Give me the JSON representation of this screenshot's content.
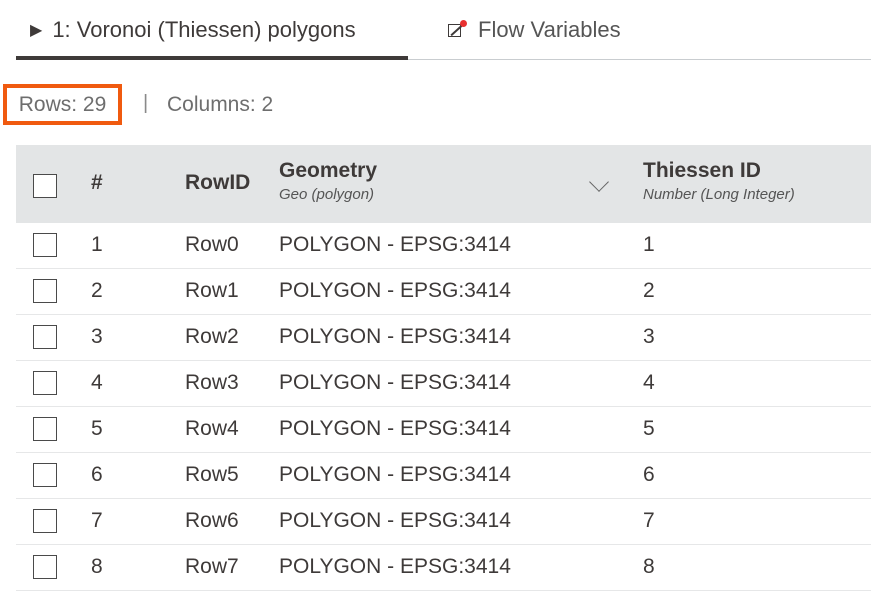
{
  "tabs": [
    {
      "label": "1: Voronoi (Thiessen) polygons",
      "icon": "play-triangle-icon",
      "active": true
    },
    {
      "label": "Flow Variables",
      "icon": "flow-variable-icon",
      "active": false
    }
  ],
  "stats": {
    "rows": "Rows: 29",
    "separator": "|",
    "columns": "Columns: 2"
  },
  "table": {
    "headers": {
      "index": "#",
      "rowid": "RowID",
      "geometry": {
        "title": "Geometry",
        "subtitle": "Geo (polygon)"
      },
      "thiessen": {
        "title": "Thiessen ID",
        "subtitle": "Number (Long Integer)"
      }
    },
    "rows": [
      {
        "index": "1",
        "rowid": "Row0",
        "geometry": "POLYGON - EPSG:3414",
        "thiessen": "1"
      },
      {
        "index": "2",
        "rowid": "Row1",
        "geometry": "POLYGON - EPSG:3414",
        "thiessen": "2"
      },
      {
        "index": "3",
        "rowid": "Row2",
        "geometry": "POLYGON - EPSG:3414",
        "thiessen": "3"
      },
      {
        "index": "4",
        "rowid": "Row3",
        "geometry": "POLYGON - EPSG:3414",
        "thiessen": "4"
      },
      {
        "index": "5",
        "rowid": "Row4",
        "geometry": "POLYGON - EPSG:3414",
        "thiessen": "5"
      },
      {
        "index": "6",
        "rowid": "Row5",
        "geometry": "POLYGON - EPSG:3414",
        "thiessen": "6"
      },
      {
        "index": "7",
        "rowid": "Row6",
        "geometry": "POLYGON - EPSG:3414",
        "thiessen": "7"
      },
      {
        "index": "8",
        "rowid": "Row7",
        "geometry": "POLYGON - EPSG:3414",
        "thiessen": "8"
      }
    ]
  },
  "colors": {
    "highlight": "#f05a0f",
    "header_bg": "#e3e5e6",
    "flow_dot": "#e8302f",
    "text": "#3e3a39"
  }
}
